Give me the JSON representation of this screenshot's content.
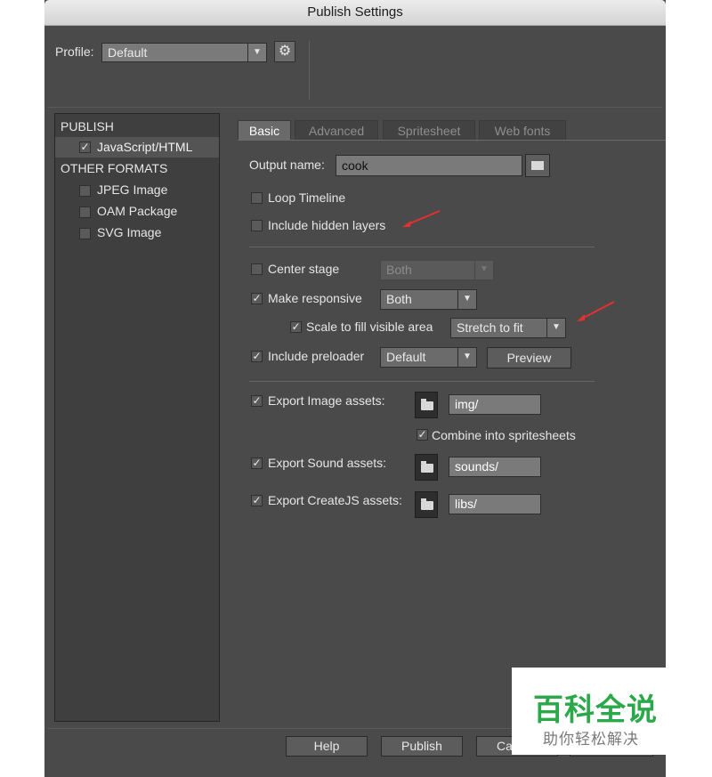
{
  "window": {
    "title": "Publish Settings"
  },
  "profile": {
    "label": "Profile:",
    "value": "Default"
  },
  "sidebar": {
    "sections": [
      {
        "heading": "PUBLISH",
        "items": [
          {
            "label": "JavaScript/HTML",
            "checked": true
          }
        ]
      },
      {
        "heading": "OTHER FORMATS",
        "items": [
          {
            "label": "JPEG Image",
            "checked": false
          },
          {
            "label": "OAM Package",
            "checked": false
          },
          {
            "label": "SVG Image",
            "checked": false
          }
        ]
      }
    ]
  },
  "tabs": [
    "Basic",
    "Advanced",
    "Spritesheet",
    "Web fonts"
  ],
  "basic": {
    "output_name_label": "Output name:",
    "output_name_value": "cook",
    "loop_timeline": "Loop Timeline",
    "include_hidden_layers": "Include hidden layers",
    "center_stage": "Center stage",
    "center_stage_value": "Both",
    "make_responsive": "Make responsive",
    "make_responsive_value": "Both",
    "scale_to_fill": "Scale to fill visible area",
    "scale_to_fill_value": "Stretch to fit",
    "include_preloader": "Include preloader",
    "include_preloader_value": "Default",
    "preview_button": "Preview",
    "export_image_assets": "Export Image assets:",
    "image_path": "img/",
    "combine_spritesheets": "Combine into spritesheets",
    "export_sound_assets": "Export Sound assets:",
    "sound_path": "sounds/",
    "export_createjs_assets": "Export CreateJS assets:",
    "createjs_path": "libs/"
  },
  "footer": {
    "help": "Help",
    "publish": "Publish",
    "cancel_partial": "Ca"
  },
  "watermark": {
    "title": "百科全说",
    "subtitle": "助你轻松解决"
  },
  "colors": {
    "panel": "#4a4a4a",
    "annotation_arrow": "#e53030",
    "watermark_green": "#2aa84a"
  }
}
